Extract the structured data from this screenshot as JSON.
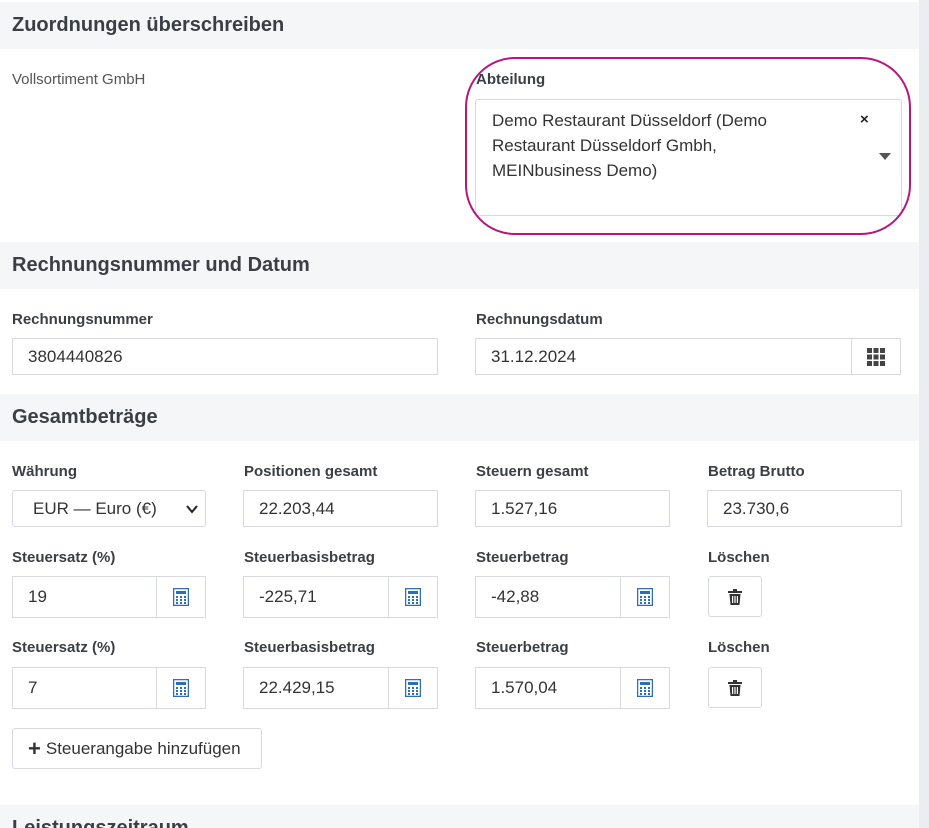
{
  "sections": {
    "zuordnungen": {
      "title": "Zuordnungen überschreiben",
      "company": "Vollsortiment GmbH",
      "abteilung_label": "Abteilung",
      "abteilung_value": "Demo Restaurant Düsseldorf (Demo Restaurant Düsseldorf Gmbh, MEINbusiness Demo)",
      "clear_symbol": "×"
    },
    "rechnung": {
      "title": "Rechnungsnummer und Datum",
      "nummer_label": "Rechnungsnummer",
      "nummer_value": "3804440826",
      "datum_label": "Rechnungsdatum",
      "datum_value": "31.12.2024"
    },
    "gesamt": {
      "title": "Gesamtbeträge",
      "waehrung_label": "Währung",
      "waehrung_value": "EUR — Euro (€)",
      "positionen_label": "Positionen gesamt",
      "positionen_value": "22.203,44",
      "steuern_label": "Steuern gesamt",
      "steuern_value": "1.527,16",
      "brutto_label": "Betrag Brutto",
      "brutto_value": "23.730,6",
      "tax_rows": [
        {
          "satz_label": "Steuersatz (%)",
          "satz_value": "19",
          "basis_label": "Steuerbasisbetrag",
          "basis_value": "-225,71",
          "betrag_label": "Steuerbetrag",
          "betrag_value": "-42,88",
          "loeschen_label": "Löschen"
        },
        {
          "satz_label": "Steuersatz (%)",
          "satz_value": "7",
          "basis_label": "Steuerbasisbetrag",
          "basis_value": "22.429,15",
          "betrag_label": "Steuerbetrag",
          "betrag_value": "1.570,04",
          "loeschen_label": "Löschen"
        }
      ],
      "add_button_label": "Steuerangabe hinzufügen"
    },
    "leistung": {
      "title": "Leistungszeitraum"
    }
  },
  "icons": {
    "calendar": "calendar-grid-icon",
    "calculator": "calculator-icon",
    "trash": "trash-icon",
    "plus": "plus-icon"
  },
  "colors": {
    "highlight": "#b4177f",
    "icon_blue": "#2e6eb5"
  }
}
